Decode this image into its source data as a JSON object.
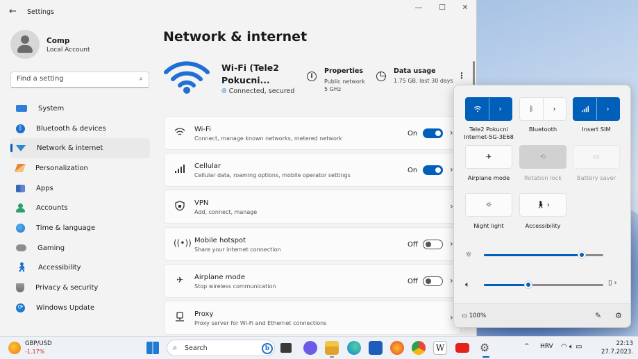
{
  "window": {
    "title": "Settings",
    "controls": {
      "minimize": "—",
      "maximize": "☐",
      "close": "✕"
    }
  },
  "profile": {
    "name": "Comp",
    "type": "Local Account"
  },
  "search": {
    "placeholder": "Find a setting"
  },
  "nav": {
    "items": [
      {
        "label": "System",
        "icon": "system-icon",
        "active": false
      },
      {
        "label": "Bluetooth & devices",
        "icon": "bluetooth-icon",
        "active": false
      },
      {
        "label": "Network & internet",
        "icon": "network-icon",
        "active": true
      },
      {
        "label": "Personalization",
        "icon": "brush-icon",
        "active": false
      },
      {
        "label": "Apps",
        "icon": "apps-icon",
        "active": false
      },
      {
        "label": "Accounts",
        "icon": "accounts-icon",
        "active": false
      },
      {
        "label": "Time & language",
        "icon": "globe-clock-icon",
        "active": false
      },
      {
        "label": "Gaming",
        "icon": "gamepad-icon",
        "active": false
      },
      {
        "label": "Accessibility",
        "icon": "accessibility-icon",
        "active": false
      },
      {
        "label": "Privacy & security",
        "icon": "shield-icon",
        "active": false
      },
      {
        "label": "Windows Update",
        "icon": "update-icon",
        "active": false
      }
    ]
  },
  "page": {
    "title": "Network & internet"
  },
  "hero": {
    "ssid_line1": "Wi-Fi (Tele2",
    "ssid_line2": "Pokucni...",
    "status": "Connected, secured",
    "properties": {
      "title": "Properties",
      "line1": "Public network",
      "line2": "5 GHz"
    },
    "usage": {
      "title": "Data usage",
      "detail": "1.75 GB, last 30 days"
    },
    "more": "⋮"
  },
  "cards": [
    {
      "title": "Wi-Fi",
      "subtitle": "Connect, manage known networks, metered network",
      "state": "On",
      "toggle": "on",
      "icon": "wifi-icon"
    },
    {
      "title": "Cellular",
      "subtitle": "Cellular data, roaming options, mobile operator settings",
      "state": "On",
      "toggle": "on",
      "icon": "cellular-icon"
    },
    {
      "title": "VPN",
      "subtitle": "Add, connect, manage",
      "state": "",
      "toggle": "none",
      "icon": "vpn-shield-icon"
    },
    {
      "title": "Mobile hotspot",
      "subtitle": "Share your internet connection",
      "state": "Off",
      "toggle": "off",
      "icon": "hotspot-icon"
    },
    {
      "title": "Airplane mode",
      "subtitle": "Stop wireless communication",
      "state": "Off",
      "toggle": "off",
      "icon": "airplane-icon"
    },
    {
      "title": "Proxy",
      "subtitle": "Proxy server for Wi-Fi and Ethernet connections",
      "state": "",
      "toggle": "none",
      "icon": "proxy-icon"
    }
  ],
  "quick": {
    "tiles": [
      {
        "label": "Tele2 Pokucni Internet-5G-3E68",
        "state": "on"
      },
      {
        "label": "Bluetooth",
        "state": "off"
      },
      {
        "label": "Insert SIM",
        "state": "on"
      },
      {
        "label": "Airplane mode",
        "state": "off"
      },
      {
        "label": "Rotation lock",
        "state": "disabled"
      },
      {
        "label": "Battery saver",
        "state": "disabled"
      },
      {
        "label": "Night light",
        "state": "off"
      },
      {
        "label": "Accessibility",
        "state": "off"
      }
    ],
    "brightness": 0.82,
    "volume": 0.37,
    "battery": "100%"
  },
  "taskbar": {
    "widget": {
      "title": "GBP/USD",
      "value": "-1.17%"
    },
    "search_label": "Search",
    "tray": {
      "language": "HRV",
      "chevron": "^"
    },
    "clock": {
      "time": "22:13",
      "date": "27.7.2023."
    }
  },
  "colors": {
    "accent": "#005fb8",
    "window_bg": "#f3f3f3",
    "negative": "#c42b1c"
  }
}
